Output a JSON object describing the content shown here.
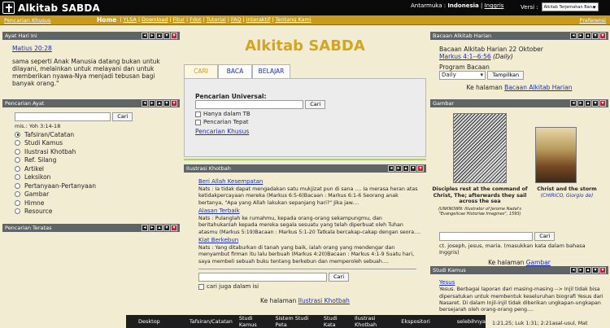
{
  "header": {
    "logo_text": "Alkitab SABDA",
    "interface_label": "Antarmuka :",
    "lang_current": "Indonesia",
    "lang_sep": "|",
    "lang_other": "Inggris",
    "version_label": "Versi :",
    "version_value": "Alkitab Terjemahan Baru"
  },
  "menubar": {
    "left": "Pencarian Khusus",
    "items": [
      "Home",
      "YLSA",
      "Download",
      "Fitur",
      "Fdot",
      "Tutorial",
      "FAQ",
      "Interaktif",
      "Tentang Kami"
    ],
    "right": "Preferensi"
  },
  "ayat_hari_ini": {
    "title": "Ayat Hari Ini",
    "ref": "Matius 20:28",
    "text": "sama seperti Anak Manusia datang bukan untuk dilayani, melainkan untuk melayani dan untuk memberikan nyawa-Nya menjadi tebusan bagi banyak orang.\""
  },
  "pencarian_ayat": {
    "title": "Pencarian Ayat",
    "button": "Cari",
    "hint": "mis.: Yoh 3:14-18",
    "options": [
      "Tafsiran/Catatan",
      "Studi Kamus",
      "Ilustrasi Khotbah",
      "Ref. Silang",
      "Artikel",
      "Leksikon",
      "Pertanyaan-Pertanyaan",
      "Gambar",
      "Himne",
      "Resource"
    ]
  },
  "pencarian_teratas": {
    "title": "Pencarian Teratas"
  },
  "center": {
    "title": "Alkitab SABDA",
    "tabs": [
      "CARI",
      "BACA",
      "BELAJAR"
    ],
    "universal_label": "Pencarian Universal:",
    "universal_button": "Cari",
    "check1": "Hanya dalam TB",
    "check2": "Pencarian Tepat",
    "special_link": "Pencarian Khusus"
  },
  "ilustrasi": {
    "title": "Ilustrasi Khotbah",
    "entries": [
      {
        "title": "Beri Allah Kesempatan",
        "text": "Nats : Ia tidak dapat mengadakan satu mukjizat pun di sana .... Ia merasa heran atas ketidakpercayaan mereka (Markus 6:5-6)Bacaan : Markus 6:1-6 Seorang anak bertanya, \"Apa yang Allah lakukan sepanjang hari?\" Jika jaw...."
      },
      {
        "title": "Alasan Terbaik",
        "text": "Nats : Pulanglah ke rumahmu, kepada orang-orang sekampungmu, dan beritahukanlah kepada mereka segala sesuatu yang telah diperbuat oleh Tuhan atasmu (Markus 5:19)Bacaan : Markus 5:1-20 Tatkala bercakap-cakap dengan seora...."
      },
      {
        "title": "Kiat Berkebun",
        "text": "Nats : Yang ditaburkan di tanah yang baik, ialah orang yang mendengar dan menyambut firman itu lalu berbuah (Markus 4:20)Bacaan : Markus 4:1-9 Suatu hari, saya membeli sebuah buku tentang berkebun dan memperoleh sebuah...."
      }
    ],
    "button": "Cari",
    "check": "cari juga dalam isi",
    "footer_prefix": "Ke halaman",
    "footer_link": "Ilustrasi Khotbah"
  },
  "bacaan": {
    "title": "Bacaan Alkitab Harian",
    "date_text": "Bacaan Alkitab Harian 22 Oktober",
    "ref": "Markus 4:1--6:56",
    "ref_suffix": "(Daily)",
    "program_label": "Program Bacaan",
    "select_value": "Daily",
    "button": "Tampilkan",
    "footer_prefix": "Ke halaman",
    "footer_link": "Bacaan Alkitab Harian"
  },
  "gambar": {
    "title": "Gambar",
    "img1_title": "Disciples rest at the command of Christ, The; afterwards they sail across the sea",
    "img1_credit": "(UNKNOWN: Illustrator of Jerome Nadal's \"Evangelicae Historiae Imagines\", 1593)",
    "img2_title": "Christ and the storm",
    "img2_credit": "(CHIRICO, Giorgio de)",
    "button": "Cari",
    "hint": "ct. joseph, jesus, maria. (masukkan kata dalam bahasa Inggris)",
    "footer_prefix": "Ke halaman",
    "footer_link": "Gambar"
  },
  "studi_kamus": {
    "title": "Studi Kamus",
    "link": "Yesus",
    "text": "Yesus. Berbagai laporan dari masing-masing --> Injil tidak bisa dipersatukan untuk membentuk keseluruhan biografi Yesus dari Nasaret. Di dalam Injil-injil tidak diberikan ungkapan-ungkapan bersejarah oleh orang-orang peng...."
  },
  "taskbar": {
    "items": [
      "Desktop",
      "Tafsiran/Catatan",
      "Studi Kamus",
      "Sistem Studi Peta",
      "Studi Kata",
      "Ilustrasi Khotbah",
      "Ekspositori",
      "selebihnya"
    ],
    "bottom_text": "1:21,25; Luk 1:31; 2:21asal-usul, Mat"
  }
}
